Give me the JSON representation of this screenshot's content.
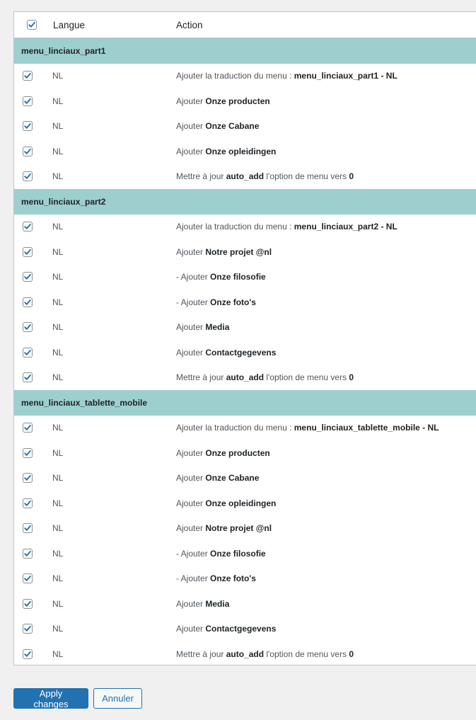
{
  "header": {
    "lang_label": "Langue",
    "action_label": "Action"
  },
  "groups": [
    {
      "name": "menu_linciaux_part1",
      "rows": [
        {
          "lang": "NL",
          "prefix": "Ajouter la traduction du menu : ",
          "bold": "menu_linciaux_part1 - NL",
          "suffix": ""
        },
        {
          "lang": "NL",
          "prefix": "Ajouter ",
          "bold": "Onze producten",
          "suffix": ""
        },
        {
          "lang": "NL",
          "prefix": "Ajouter ",
          "bold": "Onze Cabane",
          "suffix": ""
        },
        {
          "lang": "NL",
          "prefix": "Ajouter ",
          "bold": "Onze opleidingen",
          "suffix": ""
        },
        {
          "lang": "NL",
          "prefix": "Mettre à jour ",
          "bold": "auto_add",
          "suffix": " l'option de menu vers ",
          "bold2": "0"
        }
      ]
    },
    {
      "name": "menu_linciaux_part2",
      "rows": [
        {
          "lang": "NL",
          "prefix": "Ajouter la traduction du menu : ",
          "bold": "menu_linciaux_part2 - NL",
          "suffix": ""
        },
        {
          "lang": "NL",
          "prefix": "Ajouter ",
          "bold": "Notre projet @nl",
          "suffix": ""
        },
        {
          "lang": "NL",
          "prefix": "- Ajouter ",
          "bold": "Onze filosofie",
          "suffix": ""
        },
        {
          "lang": "NL",
          "prefix": "- Ajouter ",
          "bold": "Onze foto's",
          "suffix": ""
        },
        {
          "lang": "NL",
          "prefix": "Ajouter ",
          "bold": "Media",
          "suffix": ""
        },
        {
          "lang": "NL",
          "prefix": "Ajouter ",
          "bold": "Contactgegevens",
          "suffix": ""
        },
        {
          "lang": "NL",
          "prefix": "Mettre à jour ",
          "bold": "auto_add",
          "suffix": " l'option de menu vers ",
          "bold2": "0"
        }
      ]
    },
    {
      "name": "menu_linciaux_tablette_mobile",
      "rows": [
        {
          "lang": "NL",
          "prefix": "Ajouter la traduction du menu : ",
          "bold": "menu_linciaux_tablette_mobile - NL",
          "suffix": ""
        },
        {
          "lang": "NL",
          "prefix": "Ajouter ",
          "bold": "Onze producten",
          "suffix": ""
        },
        {
          "lang": "NL",
          "prefix": "Ajouter ",
          "bold": "Onze Cabane",
          "suffix": ""
        },
        {
          "lang": "NL",
          "prefix": "Ajouter ",
          "bold": "Onze opleidingen",
          "suffix": ""
        },
        {
          "lang": "NL",
          "prefix": "Ajouter ",
          "bold": "Notre projet @nl",
          "suffix": ""
        },
        {
          "lang": "NL",
          "prefix": "- Ajouter ",
          "bold": "Onze filosofie",
          "suffix": ""
        },
        {
          "lang": "NL",
          "prefix": "- Ajouter ",
          "bold": "Onze foto's",
          "suffix": ""
        },
        {
          "lang": "NL",
          "prefix": "Ajouter ",
          "bold": "Media",
          "suffix": ""
        },
        {
          "lang": "NL",
          "prefix": "Ajouter ",
          "bold": "Contactgegevens",
          "suffix": ""
        },
        {
          "lang": "NL",
          "prefix": "Mettre à jour ",
          "bold": "auto_add",
          "suffix": " l'option de menu vers ",
          "bold2": "0"
        }
      ]
    }
  ],
  "buttons": {
    "apply_label": "Apply changes",
    "cancel_label": "Annuler"
  },
  "colors": {
    "group_bg": "#9ccfcd",
    "primary": "#2271b1",
    "check": "#2271b1"
  },
  "icons": {
    "row_checkbox": "checkmark-icon"
  }
}
